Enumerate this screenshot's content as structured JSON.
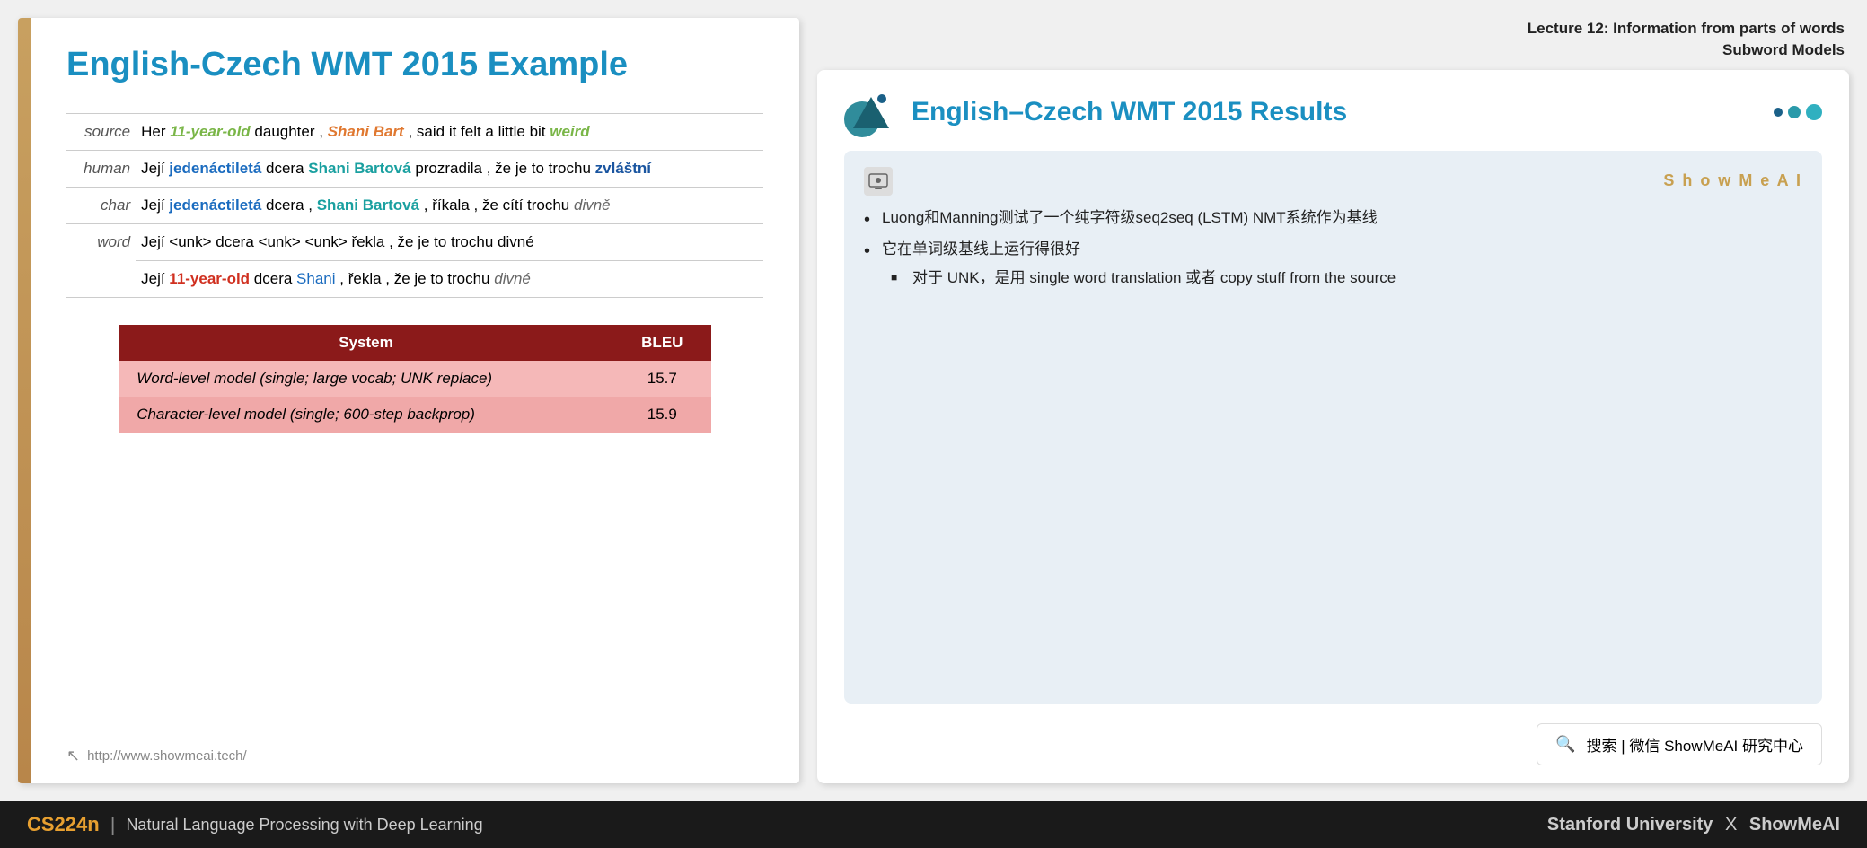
{
  "left_panel": {
    "title": "English-Czech WMT 2015 Example",
    "rows": [
      {
        "label": "source",
        "text_parts": [
          {
            "text": "Her ",
            "style": "plain"
          },
          {
            "text": "11-year-old",
            "style": "green"
          },
          {
            "text": " daughter , ",
            "style": "plain"
          },
          {
            "text": "Shani Bart",
            "style": "orange-italic"
          },
          {
            "text": " , said it felt a little bit ",
            "style": "plain"
          },
          {
            "text": "weird",
            "style": "green"
          }
        ]
      },
      {
        "label": "human",
        "text_parts": [
          {
            "text": "Její ",
            "style": "plain"
          },
          {
            "text": "jedenáctiletá",
            "style": "blue-bold"
          },
          {
            "text": " dcera ",
            "style": "plain"
          },
          {
            "text": "Shani Bartová",
            "style": "teal-bold"
          },
          {
            "text": " prozradila , že je to trochu ",
            "style": "plain"
          },
          {
            "text": "zvláštní",
            "style": "dark-blue-bold"
          }
        ]
      },
      {
        "label": "char",
        "text_parts": [
          {
            "text": "Její ",
            "style": "plain"
          },
          {
            "text": "jedenáctiletá",
            "style": "blue-bold"
          },
          {
            "text": " dcera , ",
            "style": "plain"
          },
          {
            "text": "Shani Bartová",
            "style": "teal-bold"
          },
          {
            "text": " , říkala , že cítí trochu ",
            "style": "plain"
          },
          {
            "text": "divně",
            "style": "dark-italic"
          }
        ]
      },
      {
        "label": "word",
        "text_row1": "Její <unk> dcera <unk> <unk> řekla , že je to trochu divné",
        "text_parts2": [
          {
            "text": "Její ",
            "style": "plain"
          },
          {
            "text": "11-year-old",
            "style": "red-bold"
          },
          {
            "text": " dcera ",
            "style": "plain"
          },
          {
            "text": "Shani",
            "style": "blue-plain"
          },
          {
            "text": " , řekla , že je to trochu ",
            "style": "plain"
          },
          {
            "text": "divné",
            "style": "dark-italic"
          }
        ]
      }
    ],
    "table": {
      "header": [
        "System",
        "BLEU"
      ],
      "rows": [
        {
          "system": "Word-level model (single; large vocab; UNK replace)",
          "bleu": "15.7"
        },
        {
          "system": "Character-level model (single; 600-step backprop)",
          "bleu": "15.9"
        }
      ]
    },
    "footer_link": "http://www.showmeai.tech/"
  },
  "right_panel": {
    "lecture_line1": "Lecture 12: Information from parts of words",
    "lecture_line2": "Subword Models",
    "slide_title": "English–Czech WMT 2015 Results",
    "showme_brand": "S h o w M e A I",
    "bullets": [
      {
        "text": "Luong和Manning测试了一个纯字符级seq2seq (LSTM) NMT系统作为基线"
      },
      {
        "text": "它在单词级基线上运行得很好",
        "sub": "对于 UNK，是用 single word translation 或者 copy stuff from the source"
      }
    ],
    "search_box": "搜索 | 微信 ShowMeAI 研究中心"
  },
  "bottom_bar": {
    "cs_label": "CS224n",
    "separator": "|",
    "subtitle": "Natural Language Processing with Deep Learning",
    "right_text": "Stanford University  X  ShowMeAI"
  }
}
